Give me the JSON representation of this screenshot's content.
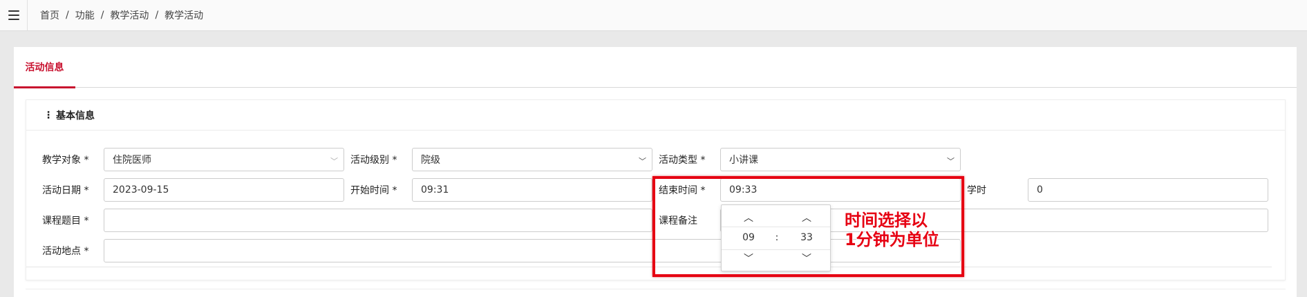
{
  "breadcrumb": [
    "首页",
    "功能",
    "教学活动",
    "教学活动"
  ],
  "breadcrumb_sep": "/",
  "tab": {
    "label": "活动信息"
  },
  "section": {
    "title": "基本信息"
  },
  "form": {
    "teach_target": {
      "label": "教学对象 *",
      "value": "住院医师"
    },
    "activity_level": {
      "label": "活动级别 *",
      "value": "院级"
    },
    "activity_type": {
      "label": "活动类型 *",
      "value": "小讲课"
    },
    "activity_date": {
      "label": "活动日期 *",
      "value": "2023-09-15"
    },
    "start_time": {
      "label": "开始时间 *",
      "value": "09:31"
    },
    "end_time": {
      "label": "结束时间 *",
      "value": "09:33"
    },
    "class_hours": {
      "label": "学时",
      "value": "0"
    },
    "course_title": {
      "label": "课程题目 *",
      "value": ""
    },
    "course_note": {
      "label": "课程备注",
      "value": ""
    },
    "location": {
      "label": "活动地点 *",
      "value": ""
    }
  },
  "time_picker": {
    "hour": "09",
    "minute": "33",
    "separator": ":"
  },
  "annotation": "时间选择以\n1分钟为单位",
  "colors": {
    "accent": "#c8102e",
    "highlight": "#e60012"
  },
  "icons": {
    "menu": "hamburger-icon",
    "dropdown": "chevron-down-icon",
    "increment": "chevron-up-icon",
    "decrement": "chevron-down-icon"
  }
}
